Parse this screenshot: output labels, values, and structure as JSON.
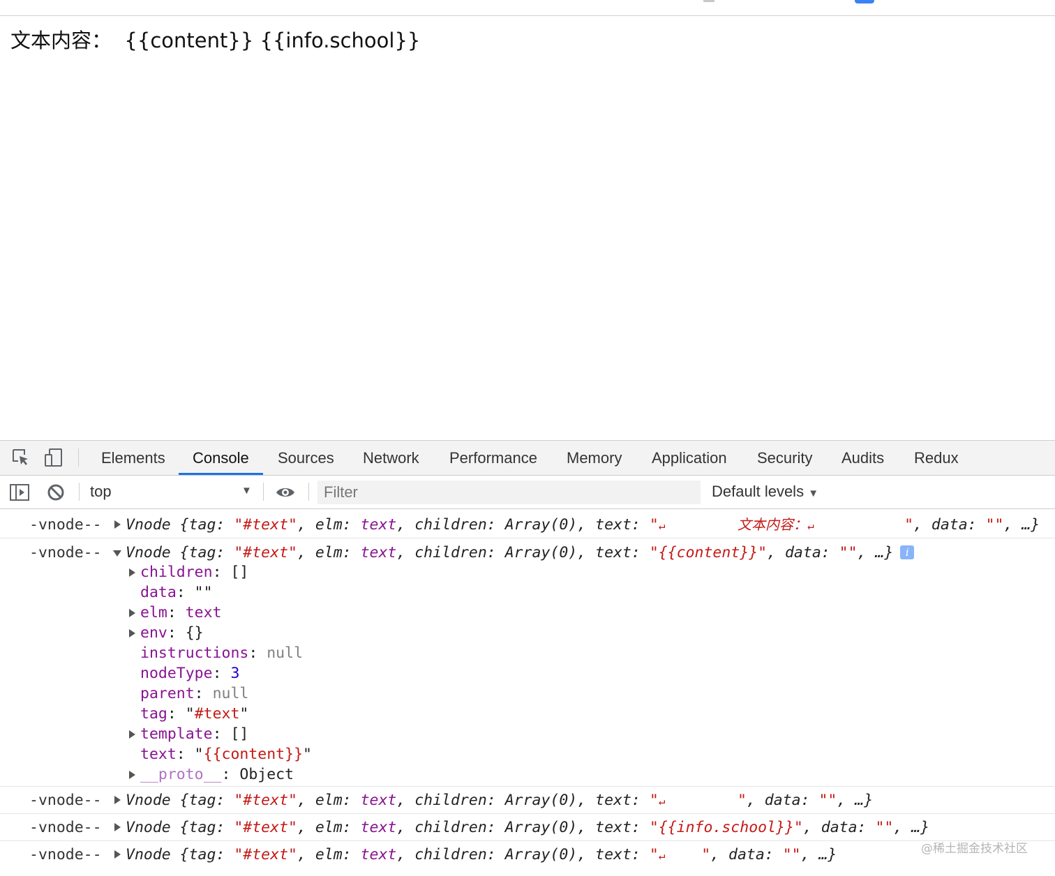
{
  "page": {
    "text": "文本内容：  {{content}} {{info.school}}"
  },
  "devtools": {
    "tabs": [
      "Elements",
      "Console",
      "Sources",
      "Network",
      "Performance",
      "Memory",
      "Application",
      "Security",
      "Audits",
      "Redux"
    ],
    "active_tab": "Console",
    "toolbar": {
      "context": "top",
      "filter_placeholder": "Filter",
      "levels": "Default levels"
    },
    "accent_color": "#1a73e8",
    "icons": [
      "inspect-element-icon",
      "device-toolbar-icon",
      "sidebar-toggle-icon",
      "clear-console-icon",
      "eye-icon",
      "info-icon",
      "return-arrow-icon"
    ]
  },
  "console": {
    "prefix": "-vnode--",
    "entries": [
      {
        "expanded": false,
        "summary_start": "Vnode {tag: ",
        "tag": "\"#text\"",
        "elm_key": ", elm: ",
        "elm": "text",
        "children_key": ", children: ",
        "children": "Array(0)",
        "text_key": ", text: ",
        "text_open": "\"",
        "text_value_pre": "        ",
        "text_value_cjk": "文本内容：",
        "text_value_post": "          ",
        "text_close": "\"",
        "data_key": ", data: ",
        "data": "\"\"",
        "summary_end": ", …}"
      },
      {
        "expanded": true,
        "summary_start": "Vnode {tag: ",
        "tag": "\"#text\"",
        "elm_key": ", elm: ",
        "elm": "text",
        "children_key": ", children: ",
        "children": "Array(0)",
        "text_key": ", text: ",
        "text_value": "\"{{content}}\"",
        "data_key": ", data: ",
        "data": "\"\"",
        "summary_end": ", …}",
        "properties": [
          {
            "key": "children",
            "sep": ": ",
            "value": "[]",
            "expandable": true
          },
          {
            "key": "data",
            "sep": ": ",
            "value": "\"\"",
            "expandable": false
          },
          {
            "key": "elm",
            "sep": ": ",
            "value": "text",
            "expandable": true
          },
          {
            "key": "env",
            "sep": ": ",
            "value": "{}",
            "expandable": true
          },
          {
            "key": "instructions",
            "sep": ": ",
            "value": "null",
            "expandable": false
          },
          {
            "key": "nodeType",
            "sep": ": ",
            "value": "3",
            "expandable": false
          },
          {
            "key": "parent",
            "sep": ": ",
            "value": "null",
            "expandable": false
          },
          {
            "key": "tag",
            "sep": ": \"",
            "value": "#text",
            "close": "\"",
            "expandable": false
          },
          {
            "key": "template",
            "sep": ": ",
            "value": "[]",
            "expandable": true
          },
          {
            "key": "text",
            "sep": ": \"",
            "value": "{{content}}",
            "close": "\"",
            "expandable": false
          },
          {
            "key": "__proto__",
            "sep": ": ",
            "value": "Object",
            "expandable": true
          }
        ]
      },
      {
        "expanded": false,
        "summary_start": "Vnode {tag: ",
        "tag": "\"#text\"",
        "elm_key": ", elm: ",
        "elm": "text",
        "children_key": ", children: ",
        "children": "Array(0)",
        "text_key": ", text: ",
        "text_open": "\"",
        "text_value_post": "        ",
        "text_close": "\"",
        "data_key": ", data: ",
        "data": "\"\"",
        "summary_end": ", …}"
      },
      {
        "expanded": false,
        "summary_start": "Vnode {tag: ",
        "tag": "\"#text\"",
        "elm_key": ", elm: ",
        "elm": "text",
        "children_key": ", children: ",
        "children": "Array(0)",
        "text_key": ", text: ",
        "text_value": "\"{{info.school}}\"",
        "data_key": ", data: ",
        "data": "\"\"",
        "summary_end": ", …}"
      },
      {
        "expanded": false,
        "summary_start": "Vnode {tag: ",
        "tag": "\"#text\"",
        "elm_key": ", elm: ",
        "elm": "text",
        "children_key": ", children: ",
        "children": "Array(0)",
        "text_key": ", text: ",
        "text_open": "\"",
        "text_value_post": "    ",
        "text_close": "\"",
        "data_key": ", data: ",
        "data": "\"\"",
        "summary_end": ", …}"
      }
    ]
  },
  "watermark": "@稀土掘金技术社区"
}
